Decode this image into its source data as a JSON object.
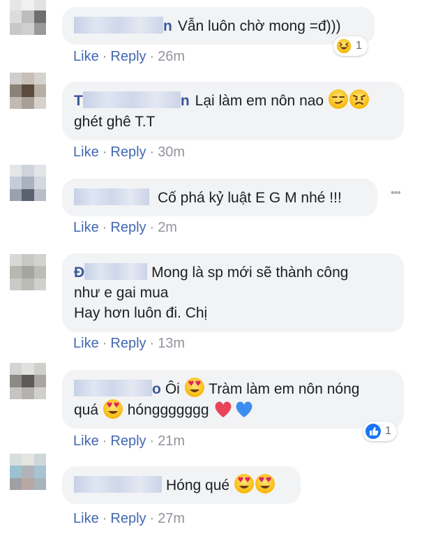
{
  "comments": [
    {
      "name_tail": "n",
      "text": "Vẫn luôn chờ mong =đ)))",
      "like": "Like",
      "reply": "Reply",
      "sep": "·",
      "time": "26m",
      "reaction_icon": "laughing-icon",
      "reaction_count": "1"
    },
    {
      "name_tail": "n",
      "name_head": "T",
      "text_line1": "Lại làm em nôn nao",
      "text_line2": "ghét ghê T.T",
      "like": "Like",
      "reply": "Reply",
      "sep": "·",
      "time": "30m"
    },
    {
      "text": "Cố phá kỷ luật E G M nhé !!!",
      "like": "Like",
      "reply": "Reply",
      "sep": "·",
      "time": "2m",
      "more_icon": "more-options-icon",
      "more_text": "•••"
    },
    {
      "name_head": "Đ",
      "text_line1": "Mong là sp mới sẽ thành công",
      "text_line2": "như e gai mua",
      "text_line3": "Hay hơn luôn đi. Chị",
      "like": "Like",
      "reply": "Reply",
      "sep": "·",
      "time": "13m"
    },
    {
      "text_part1": "Ôi",
      "text_part2": "Tràm làm em nôn nóng",
      "text_part3": "quá",
      "text_part4": "hónggggggg",
      "like": "Like",
      "reply": "Reply",
      "sep": "·",
      "time": "21m",
      "reaction_icon": "like-icon",
      "reaction_count": "1"
    },
    {
      "text": "Hóng qué",
      "like": "Like",
      "reply": "Reply",
      "sep": "·",
      "time": "27m"
    }
  ],
  "colors": {
    "bubble": "#f2f3f5",
    "link": "#4267b2",
    "meta": "#90949c",
    "name": "#385898"
  }
}
